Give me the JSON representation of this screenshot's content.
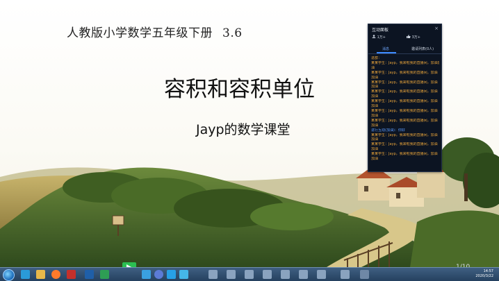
{
  "slide": {
    "header": "人教版小学数学五年级下册",
    "header_version": "3.6",
    "title": "容积和容积单位",
    "subtitle": "Jayp的数学课堂",
    "page_indicator": "1/10"
  },
  "chat_panel": {
    "title": "互动面板",
    "close": "×",
    "viewers": "1万+",
    "likes": "3万+",
    "tabs": [
      "消息",
      "邀请列表(0人)"
    ],
    "messages": [
      {
        "type": "user",
        "text": "进群："
      },
      {
        "type": "user",
        "text": "某某学生：Jayp，我来啦我的直播间，加油加"
      },
      {
        "type": "user",
        "text": "油"
      },
      {
        "type": "user",
        "text": "某某学生：Jayp，我来啦我的直播间，加油"
      },
      {
        "type": "user",
        "text": "加油"
      },
      {
        "type": "user",
        "text": "某某学生：Jayp，我来啦我的直播间，加油"
      },
      {
        "type": "user",
        "text": "加油"
      },
      {
        "type": "user",
        "text": "某某学生：Jayp，我来啦我的直播间，加油"
      },
      {
        "type": "user",
        "text": "加油"
      },
      {
        "type": "user",
        "text": "某某学生：Jayp，我来啦我的直播间，加油"
      },
      {
        "type": "user",
        "text": "加油"
      },
      {
        "type": "user",
        "text": "某某学生：Jayp，我来啦我的直播间，加油"
      },
      {
        "type": "user",
        "text": "加油"
      },
      {
        "type": "user",
        "text": "某某学生：Jayp，我来啦我的直播间，加油"
      },
      {
        "type": "user",
        "text": "加油"
      },
      {
        "type": "sys",
        "text": "进行互动(加油)：你好"
      },
      {
        "type": "user",
        "text": "某某学生：Jayp，我来啦我的直播间，加油"
      },
      {
        "type": "user",
        "text": "加油"
      },
      {
        "type": "user",
        "text": "某某学生：Jayp，我来啦我的直播间，加油"
      },
      {
        "type": "user",
        "text": "加油"
      },
      {
        "type": "user",
        "text": "某某学生：Jayp，我来啦我的直播间，加油"
      },
      {
        "type": "user",
        "text": "加油"
      }
    ]
  },
  "taskbar": {
    "time": "14:57",
    "date": "2020/3/22"
  },
  "colors": {
    "panel_bg": "#0c1422",
    "message_user": "#e8a43a",
    "message_system": "#5b9bff",
    "play_button": "#2bbf52",
    "taskbar": "#2f4e70"
  }
}
